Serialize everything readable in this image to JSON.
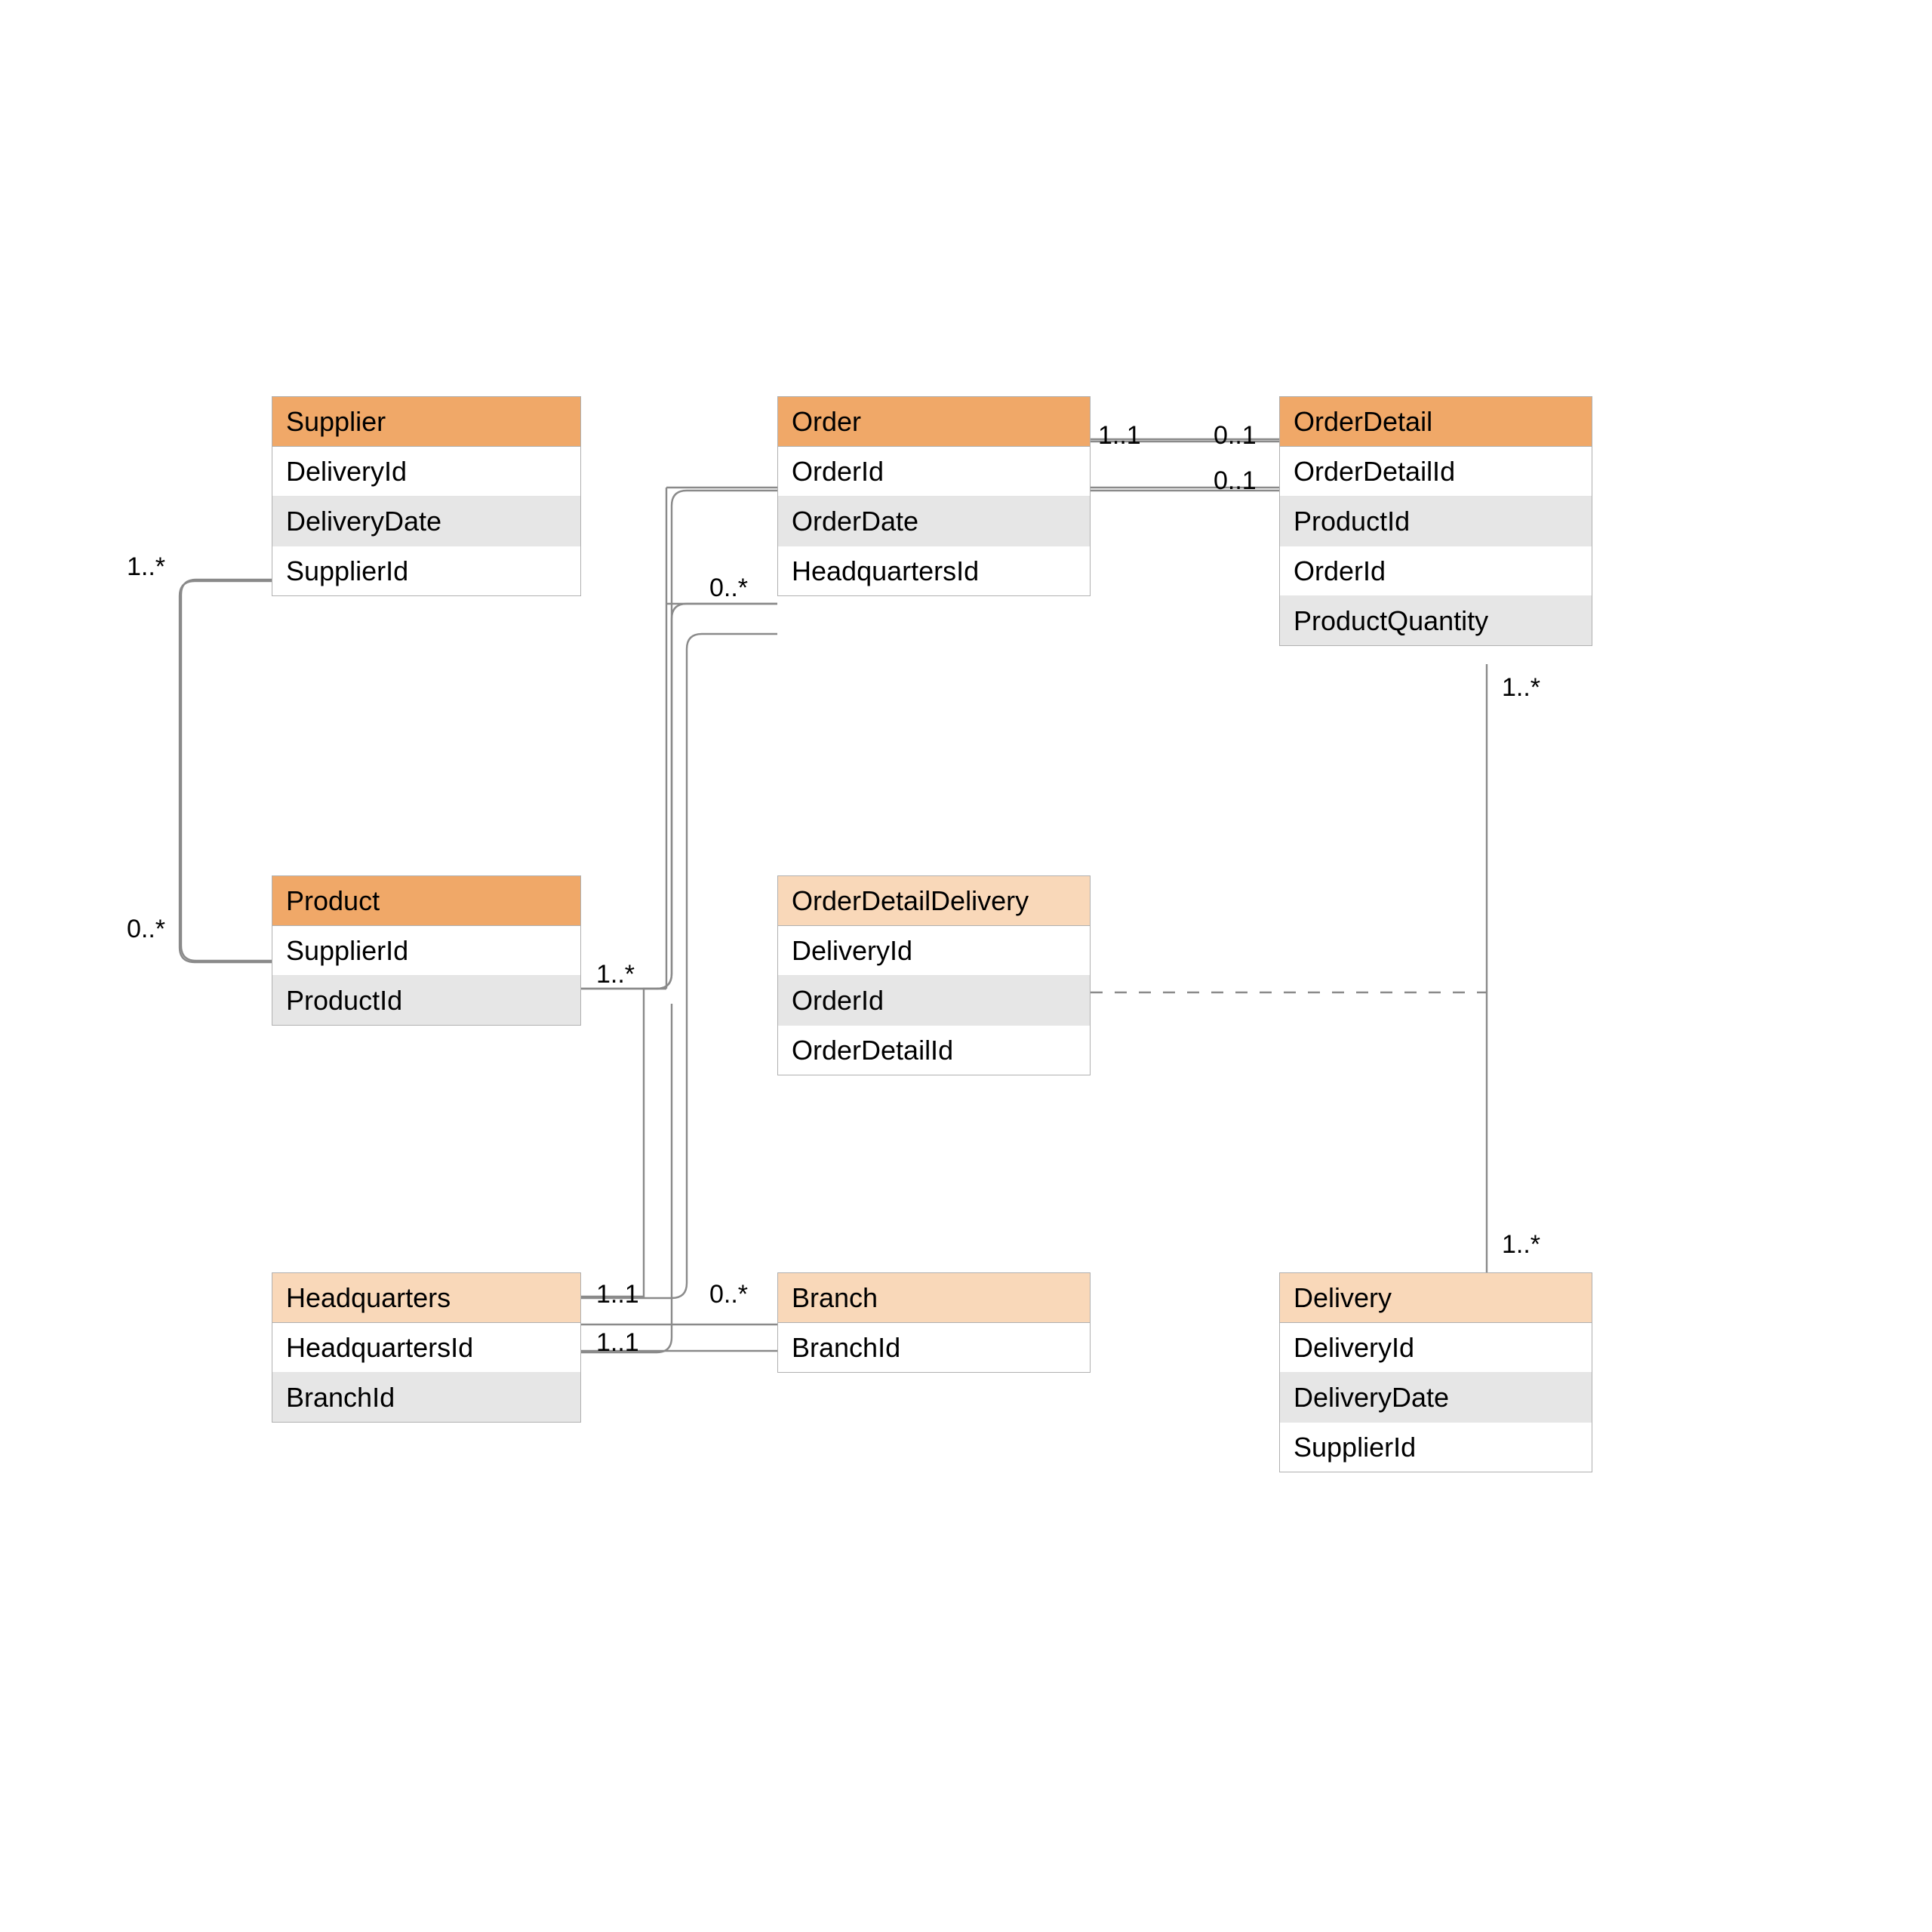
{
  "entities": {
    "supplier": {
      "title": "Supplier",
      "header_style": "dark",
      "attrs": [
        "DeliveryId",
        "DeliveryDate",
        "SupplierId"
      ]
    },
    "order": {
      "title": "Order",
      "header_style": "dark",
      "attrs": [
        "OrderId",
        "OrderDate",
        "HeadquartersId"
      ]
    },
    "orderDetail": {
      "title": "OrderDetail",
      "header_style": "dark",
      "attrs": [
        "OrderDetailId",
        "ProductId",
        "OrderId",
        "ProductQuantity"
      ]
    },
    "product": {
      "title": "Product",
      "header_style": "dark",
      "attrs": [
        "SupplierId",
        "ProductId"
      ]
    },
    "orderDetailDelivery": {
      "title": "OrderDetailDelivery",
      "header_style": "light",
      "attrs": [
        "DeliveryId",
        "OrderId",
        "OrderDetailId"
      ]
    },
    "headquarters": {
      "title": "Headquarters",
      "header_style": "light",
      "attrs": [
        "HeadquartersId",
        "BranchId"
      ]
    },
    "branch": {
      "title": "Branch",
      "header_style": "light",
      "attrs": [
        "BranchId"
      ]
    },
    "delivery": {
      "title": "Delivery",
      "header_style": "light",
      "attrs": [
        "DeliveryId",
        "DeliveryDate",
        "SupplierId"
      ]
    }
  },
  "multiplicities": {
    "supplier_product_top": "1..*",
    "supplier_product_bot": "0..*",
    "order_left": "0..*",
    "order_orderdetail_left": "1..1",
    "order_orderdetail_right": "0..1",
    "product_orderdetail_left": "1..*",
    "product_orderdetail_right": "0..1",
    "orderdetail_delivery_top": "1..*",
    "orderdetail_delivery_bot": "1..*",
    "hq_branch_left": "1..1",
    "hq_branch_right_top": "0..*",
    "hq_branch_right_bot": "1..1"
  }
}
